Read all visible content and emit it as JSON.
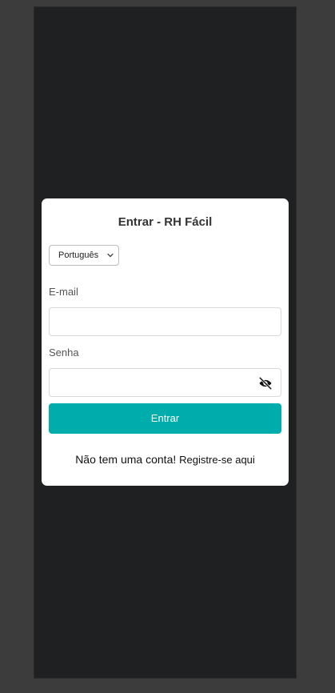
{
  "login": {
    "title": "Entrar - RH Fácil",
    "language": {
      "selected": "Português"
    },
    "email_label": "E-mail",
    "email_value": "",
    "password_label": "Senha",
    "password_value": "",
    "submit_label": "Entrar",
    "no_account_text": "Não tem uma conta!",
    "register_link": "Registre-se aqui"
  },
  "colors": {
    "page_background": "#3c3c3c",
    "viewport_background": "#1f2022",
    "card_background": "#ffffff",
    "accent": "#00adad"
  },
  "icons": {
    "language_chevron": "chevron-down-icon",
    "password_visibility": "eye-off-icon"
  }
}
